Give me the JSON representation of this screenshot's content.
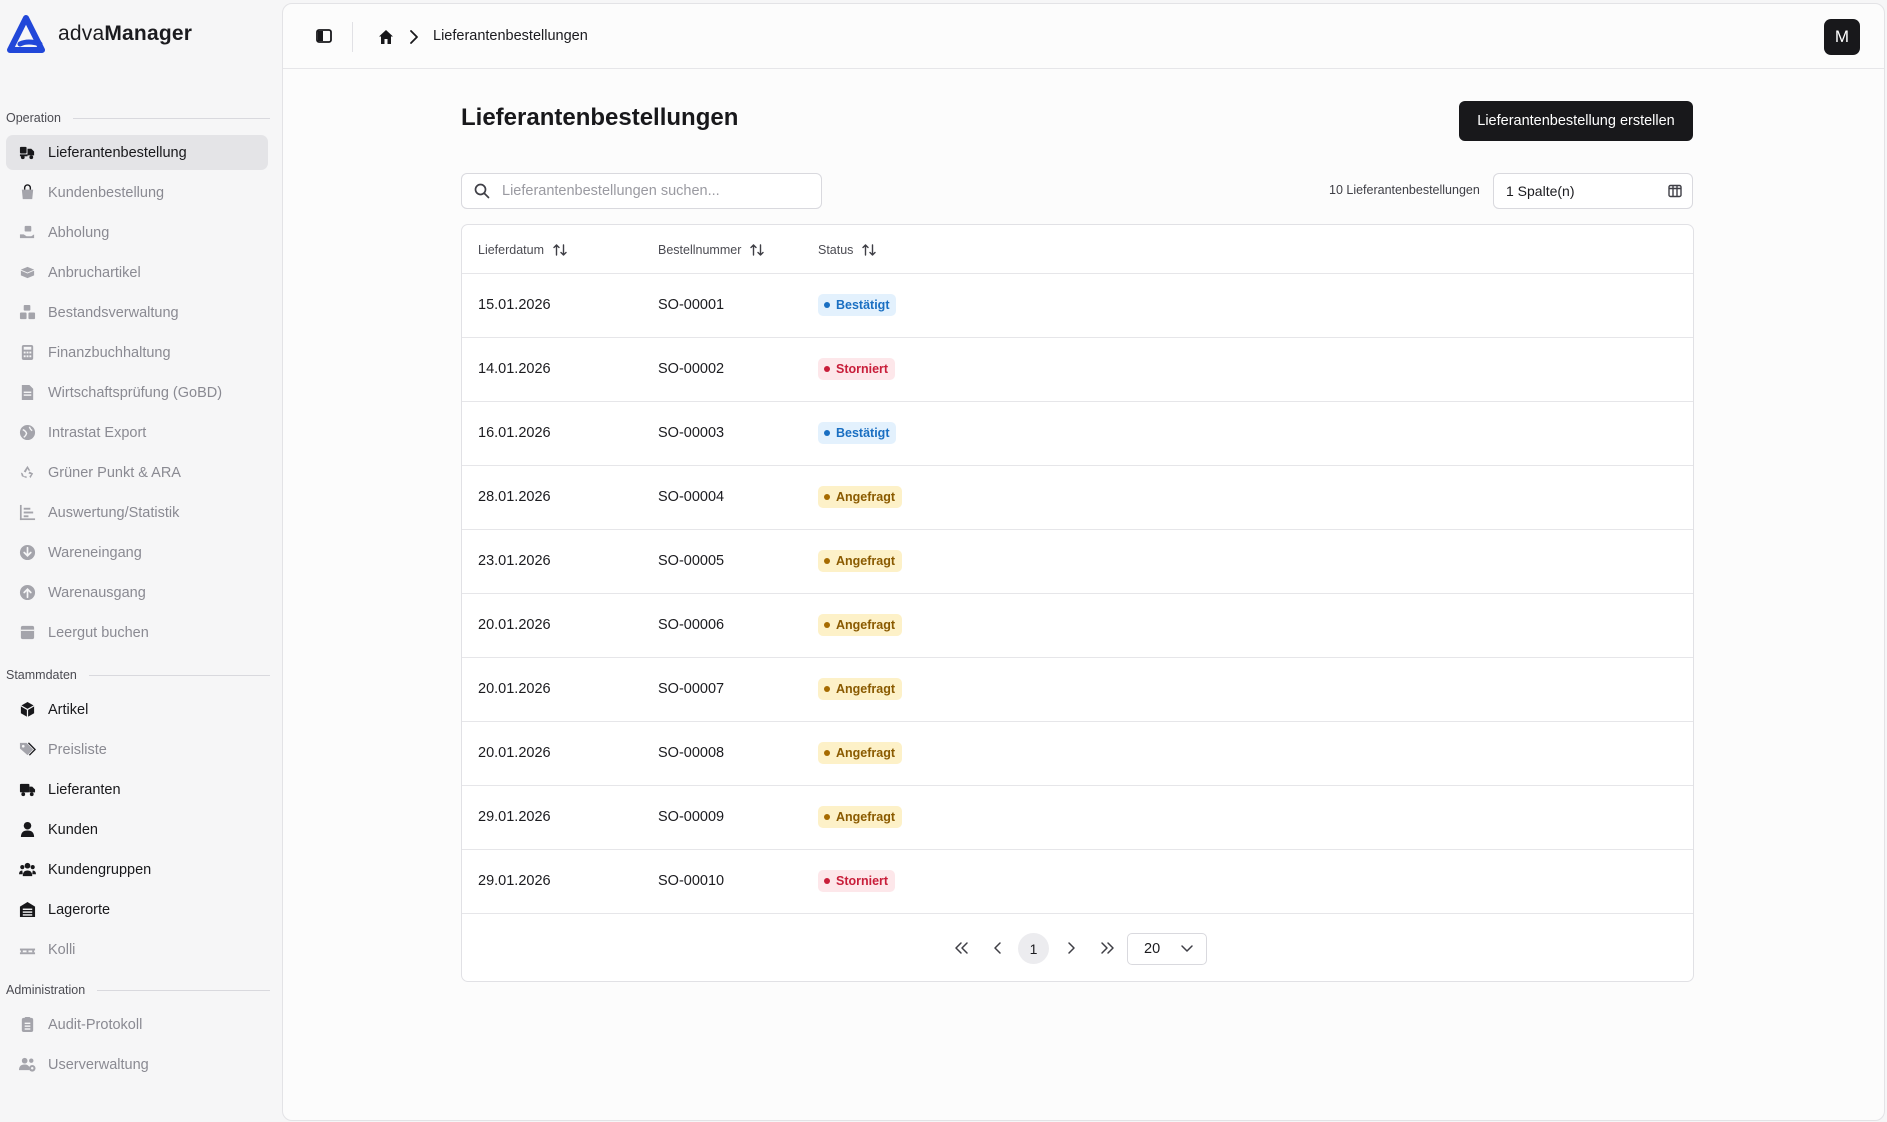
{
  "brand": {
    "name_regular": "adva",
    "name_bold": "Manager"
  },
  "sidebar": {
    "sections": [
      {
        "label": "Operation"
      },
      {
        "label": "Stammdaten"
      },
      {
        "label": "Administration"
      }
    ],
    "operation_items": [
      {
        "label": "Lieferantenbestellung",
        "icon": "truck-box-icon"
      },
      {
        "label": "Kundenbestellung",
        "icon": "shopping-bag-icon"
      },
      {
        "label": "Abholung",
        "icon": "hand-box-icon"
      },
      {
        "label": "Anbruchartikel",
        "icon": "open-box-icon"
      },
      {
        "label": "Bestandsverwaltung",
        "icon": "boxes-icon"
      },
      {
        "label": "Finanzbuchhaltung",
        "icon": "calculator-icon"
      },
      {
        "label": "Wirtschaftsprüfung (GoBD)",
        "icon": "document-check-icon"
      },
      {
        "label": "Intrastat Export",
        "icon": "globe-icon"
      },
      {
        "label": "Grüner Punkt & ARA",
        "icon": "recycle-icon"
      },
      {
        "label": "Auswertung/Statistik",
        "icon": "bar-chart-icon"
      },
      {
        "label": "Wareneingang",
        "icon": "arrow-down-circle-icon"
      },
      {
        "label": "Warenausgang",
        "icon": "arrow-up-circle-icon"
      },
      {
        "label": "Leergut buchen",
        "icon": "crate-icon"
      }
    ],
    "master_items": [
      {
        "label": "Artikel",
        "icon": "cube-icon"
      },
      {
        "label": "Preisliste",
        "icon": "tags-icon"
      },
      {
        "label": "Lieferanten",
        "icon": "truck-icon"
      },
      {
        "label": "Kunden",
        "icon": "user-icon"
      },
      {
        "label": "Kundengruppen",
        "icon": "users-icon"
      },
      {
        "label": "Lagerorte",
        "icon": "warehouse-icon"
      },
      {
        "label": "Kolli",
        "icon": "pallet-icon"
      }
    ],
    "admin_items": [
      {
        "label": "Audit-Protokoll",
        "icon": "clipboard-list-icon"
      },
      {
        "label": "Userverwaltung",
        "icon": "users-gear-icon"
      }
    ]
  },
  "topbar": {
    "breadcrumb_current": "Lieferantenbestellungen",
    "avatar_initial": "M"
  },
  "page": {
    "title": "Lieferantenbestellungen",
    "create_button": "Lieferantenbestellung erstellen",
    "search_placeholder": "Lieferantenbestellungen suchen...",
    "count_text": "10 Lieferantenbestellungen",
    "columns_select": "1 Spalte(n)"
  },
  "table": {
    "headers": [
      "Lieferdatum",
      "Bestellnummer",
      "Status"
    ],
    "rows": [
      {
        "date": "15.01.2026",
        "number": "SO-00001",
        "status": "Bestätigt",
        "tone": "blue"
      },
      {
        "date": "14.01.2026",
        "number": "SO-00002",
        "status": "Storniert",
        "tone": "red"
      },
      {
        "date": "16.01.2026",
        "number": "SO-00003",
        "status": "Bestätigt",
        "tone": "blue"
      },
      {
        "date": "28.01.2026",
        "number": "SO-00004",
        "status": "Angefragt",
        "tone": "amber"
      },
      {
        "date": "23.01.2026",
        "number": "SO-00005",
        "status": "Angefragt",
        "tone": "amber"
      },
      {
        "date": "20.01.2026",
        "number": "SO-00006",
        "status": "Angefragt",
        "tone": "amber"
      },
      {
        "date": "20.01.2026",
        "number": "SO-00007",
        "status": "Angefragt",
        "tone": "amber"
      },
      {
        "date": "20.01.2026",
        "number": "SO-00008",
        "status": "Angefragt",
        "tone": "amber"
      },
      {
        "date": "29.01.2026",
        "number": "SO-00009",
        "status": "Angefragt",
        "tone": "amber"
      },
      {
        "date": "29.01.2026",
        "number": "SO-00010",
        "status": "Storniert",
        "tone": "red"
      }
    ]
  },
  "pagination": {
    "current_page": "1",
    "page_size": "20"
  },
  "colors": {
    "accent_dark": "#18181b",
    "brand_blue": "#2147d9",
    "status_blue": "#1a6fc2",
    "status_red": "#c81e3a",
    "status_amber": "#8a5a00"
  }
}
